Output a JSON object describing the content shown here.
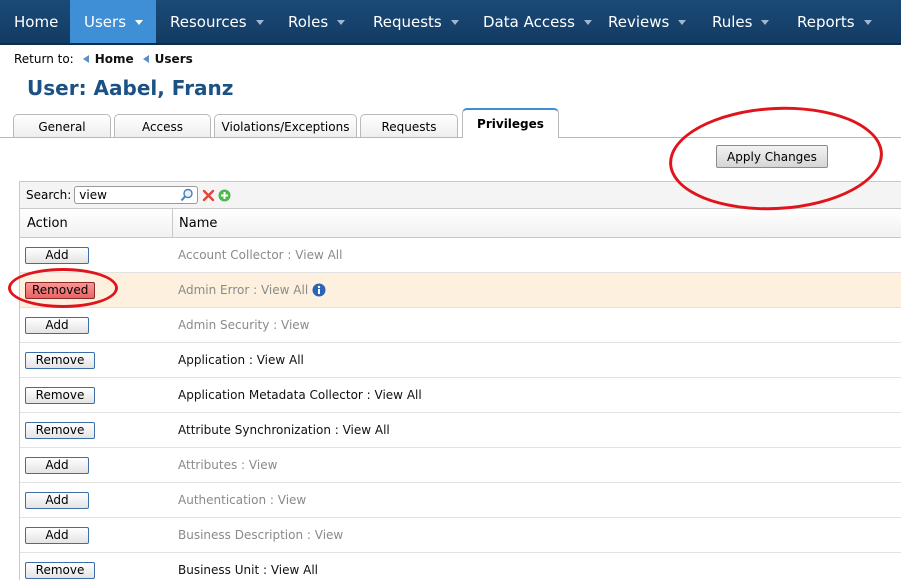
{
  "nav": {
    "items": [
      {
        "label": "Home",
        "has_menu": false
      },
      {
        "label": "Users",
        "has_menu": true,
        "active": true
      },
      {
        "label": "Resources",
        "has_menu": true
      },
      {
        "label": "Roles",
        "has_menu": true
      },
      {
        "label": "Requests",
        "has_menu": true
      },
      {
        "label": "Data Access",
        "has_menu": true
      },
      {
        "label": "Reviews",
        "has_menu": true
      },
      {
        "label": "Rules",
        "has_menu": true
      },
      {
        "label": "Reports",
        "has_menu": true
      }
    ]
  },
  "breadcrumb": {
    "prefix": "Return to:",
    "links": [
      "Home",
      "Users"
    ]
  },
  "page": {
    "title": "User: Aabel, Franz"
  },
  "tabs": [
    {
      "label": "General"
    },
    {
      "label": "Access"
    },
    {
      "label": "Violations/Exceptions"
    },
    {
      "label": "Requests"
    },
    {
      "label": "Privileges",
      "active": true
    }
  ],
  "toolbar": {
    "apply_label": "Apply Changes"
  },
  "search": {
    "label": "Search:",
    "value": "view"
  },
  "grid": {
    "columns": {
      "action": "Action",
      "name": "Name"
    },
    "rows": [
      {
        "action": "Add",
        "name": "Account Collector : View All",
        "state": "available"
      },
      {
        "action": "Removed",
        "name": "Admin Error : View All",
        "state": "removed",
        "info": true
      },
      {
        "action": "Add",
        "name": "Admin Security : View",
        "state": "available"
      },
      {
        "action": "Remove",
        "name": "Application : View All",
        "state": "granted"
      },
      {
        "action": "Remove",
        "name": "Application Metadata Collector : View All",
        "state": "granted"
      },
      {
        "action": "Remove",
        "name": "Attribute Synchronization : View All",
        "state": "granted"
      },
      {
        "action": "Add",
        "name": "Attributes : View",
        "state": "available"
      },
      {
        "action": "Add",
        "name": "Authentication : View",
        "state": "available"
      },
      {
        "action": "Add",
        "name": "Business Description : View",
        "state": "available"
      },
      {
        "action": "Remove",
        "name": "Business Unit : View All",
        "state": "granted"
      }
    ]
  },
  "colors": {
    "nav_bg": "#1b4a78",
    "nav_active": "#3f8fd6",
    "title": "#1c5184",
    "removed_btn": "#ea6464",
    "highlight_row": "#fdf0de",
    "annotation": "#e0141b"
  },
  "icons": {
    "search": "magnifier-icon",
    "clear": "clear-x-icon",
    "add_filter": "green-plus-icon",
    "info": "info-icon"
  }
}
